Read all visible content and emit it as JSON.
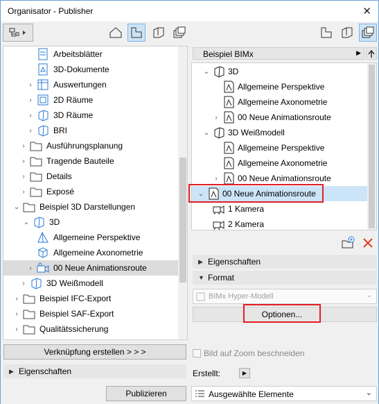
{
  "window": {
    "title": "Organisator - Publisher",
    "close_glyph": "✕"
  },
  "left_tree": {
    "items": [
      {
        "label": "Arbeitsblätter",
        "icon": "document-icon"
      },
      {
        "label": "3D-Dokumente",
        "icon": "3d-document-icon"
      },
      {
        "label": "Auswertungen",
        "icon": "schedule-icon"
      },
      {
        "label": "2D Räume",
        "icon": "2d-view-icon"
      },
      {
        "label": "3D Räume",
        "icon": "3d-view-icon"
      },
      {
        "label": "BRI",
        "icon": "3d-view-icon"
      },
      {
        "label": "Ausführungsplanung",
        "icon": "folder-icon"
      },
      {
        "label": "Tragende Bauteile",
        "icon": "folder-icon"
      },
      {
        "label": "Details",
        "icon": "folder-icon"
      },
      {
        "label": "Exposé",
        "icon": "folder-icon"
      },
      {
        "label": "Beispiel 3D Darstellungen",
        "icon": "folder-icon"
      },
      {
        "label": "3D",
        "icon": "3d-view-icon"
      },
      {
        "label": "Allgemeine Perspektive",
        "icon": "perspective-icon"
      },
      {
        "label": "Allgemeine Axonometrie",
        "icon": "axonometry-icon"
      },
      {
        "label": "00 Neue Animationsroute",
        "icon": "camera-path-icon"
      },
      {
        "label": "3D Weißmodell",
        "icon": "3d-view-icon"
      },
      {
        "label": "Beispiel IFC-Export",
        "icon": "folder-icon"
      },
      {
        "label": "Beispiel SAF-Export",
        "icon": "folder-icon"
      },
      {
        "label": "Qualitätssicherung",
        "icon": "folder-icon"
      }
    ]
  },
  "left_buttons": {
    "link_button": "Verknüpfung erstellen > > >",
    "properties_header": "Eigenschaften"
  },
  "right_panel": {
    "path_label": "Beispiel BIMx",
    "items": [
      {
        "label": "3D"
      },
      {
        "label": "Allgemeine Perspektive"
      },
      {
        "label": "Allgemeine Axonometrie"
      },
      {
        "label": "00 Neue Animationsroute"
      },
      {
        "label": "3D Weißmodell"
      },
      {
        "label": "Allgemeine Perspektive"
      },
      {
        "label": "Allgemeine Axonometrie"
      },
      {
        "label": "00 Neue Animationsroute"
      },
      {
        "label": "00 Neue Animationsroute"
      },
      {
        "label": "1 Kamera"
      },
      {
        "label": "2 Kamera"
      }
    ],
    "properties_header": "Eigenschaften",
    "format_header": "Format",
    "format_select": "BIMx Hyper-Modell",
    "options_button": "Optionen...",
    "zoom_checkbox_label": "Bild auf Zoom beschneiden",
    "create_label": "Erstellt:"
  },
  "bottom": {
    "publish_button": "Publizieren",
    "scope_select": "Ausgewählte Elemente"
  },
  "colors": {
    "accent": "#cde4f7",
    "highlight_red": "#e31e24",
    "selection_gray": "#dcdcdc"
  }
}
